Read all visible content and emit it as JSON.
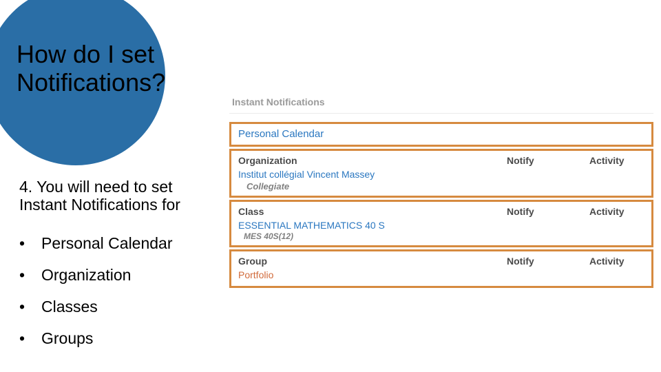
{
  "title_line1": "How do I set",
  "title_line2": "Notifications?",
  "instruction_line1": "4. You will need to set",
  "instruction_line2": "Instant Notifications for",
  "bullets": {
    "b1": "Personal Calendar",
    "b2": "Organization",
    "b3": "Classes",
    "b4": "Groups"
  },
  "panel": {
    "heading": "Instant Notifications",
    "personal": "Personal Calendar",
    "org": {
      "header": "Organization",
      "notify": "Notify",
      "activity": "Activity",
      "name": "Institut collégial Vincent Massey",
      "sub": "Collegiate"
    },
    "class": {
      "header": "Class",
      "notify": "Notify",
      "activity": "Activity",
      "name": "ESSENTIAL MATHEMATICS 40 S",
      "sub": "MES 40S(12)"
    },
    "group": {
      "header": "Group",
      "notify": "Notify",
      "activity": "Activity",
      "name": "Portfolio"
    }
  }
}
